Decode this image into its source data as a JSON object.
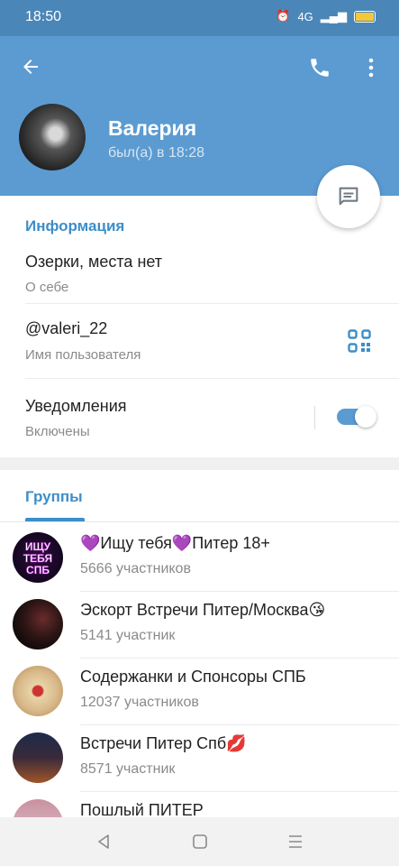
{
  "status_bar": {
    "time": "18:50",
    "network": "4G"
  },
  "profile": {
    "name": "Валерия",
    "last_seen": "был(а) в 18:28"
  },
  "info": {
    "section_title": "Информация",
    "bio_value": "Озерки, места нет",
    "bio_label": "О себе",
    "username_value": "@valeri_22",
    "username_label": "Имя пользователя",
    "notifications_value": "Уведомления",
    "notifications_label": "Включены"
  },
  "groups": {
    "tab_label": "Группы",
    "items": [
      {
        "title": "💜Ищу тебя💜Питер 18+",
        "count": "5666 участников"
      },
      {
        "title": "Эскорт Встречи Питер/Москва😘",
        "count": "5141 участник"
      },
      {
        "title": "Содержанки и Спонсоры СПБ",
        "count": "12037 участников"
      },
      {
        "title": "Встречи Питер Спб💋",
        "count": "8571 участник"
      },
      {
        "title": "Пошлый ПИТЕР",
        "count": ""
      }
    ],
    "avatar_text": [
      "ИЩУ",
      "ТЕБЯ",
      "СПБ"
    ]
  },
  "colors": {
    "header": "#5b9bd1",
    "accent": "#3d8ec9",
    "status_bar": "#4b86b8"
  },
  "icons": [
    "back-arrow-icon",
    "phone-icon",
    "more-vert-icon",
    "message-icon",
    "qr-code-icon",
    "nav-back-icon",
    "nav-home-icon",
    "nav-menu-icon"
  ]
}
